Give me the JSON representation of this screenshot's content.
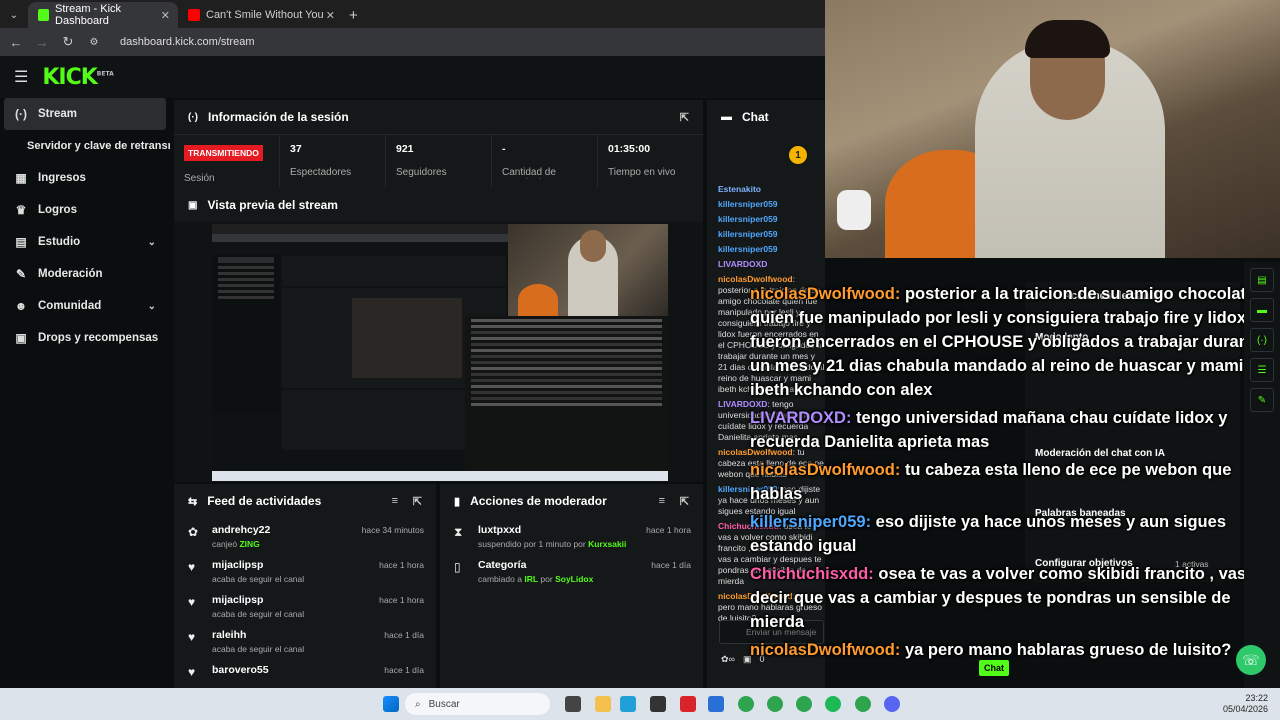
{
  "browser": {
    "tabs": [
      {
        "label": "Stream - Kick Dashboard",
        "close": "✕",
        "active": true
      },
      {
        "label": "Can't Smile Without You - Barr",
        "close": "✕",
        "active": false
      }
    ],
    "new_tab": "+",
    "url": "dashboard.kick.com/stream"
  },
  "kick": {
    "logo": "KICK",
    "logo_tag": "BETA",
    "sidebar": [
      {
        "label": "Stream",
        "icon": "stream-icon",
        "glyph": "(·)",
        "active": true
      },
      {
        "label": "Servidor y clave de retransmisión",
        "icon": "",
        "glyph": ""
      },
      {
        "label": "Ingresos",
        "icon": "dollar-icon",
        "glyph": "▦"
      },
      {
        "label": "Logros",
        "icon": "trophy-icon",
        "glyph": "♛"
      },
      {
        "label": "Estudio",
        "icon": "studio-icon",
        "glyph": "▤",
        "chevron": "⌄"
      },
      {
        "label": "Moderación",
        "icon": "wrench-icon",
        "glyph": "✎"
      },
      {
        "label": "Comunidad",
        "icon": "community-icon",
        "glyph": "☻",
        "chevron": "⌄"
      },
      {
        "label": "Drops y recompensas",
        "icon": "gift-icon",
        "glyph": "▣"
      }
    ],
    "session": {
      "title": "Información de la sesión",
      "status_badge": "TRANSMITIENDO",
      "status_label": "Sesión",
      "stats": [
        {
          "value": "37",
          "label": "Espectadores"
        },
        {
          "value": "921",
          "label": "Seguidores"
        },
        {
          "value": "-",
          "label": "Cantidad de suscripciones"
        },
        {
          "value": "01:35:00",
          "label": "Tiempo en vivo"
        }
      ]
    },
    "preview": {
      "title": "Vista previa del stream"
    },
    "feed": {
      "title": "Feed de actividades",
      "items": [
        {
          "name": "andrehcy22",
          "action": "canjeó",
          "highlight": "ZING",
          "time": "hace 34 minutos",
          "icon": "reward-icon",
          "glyph": "✿"
        },
        {
          "name": "mijaclipsp",
          "action": "acaba de seguir el canal",
          "highlight": "",
          "time": "hace 1 hora",
          "icon": "heart-icon",
          "glyph": "♥"
        },
        {
          "name": "mijaclipsp",
          "action": "acaba de seguir el canal",
          "highlight": "",
          "time": "hace 1 hora",
          "icon": "heart-icon",
          "glyph": "♥"
        },
        {
          "name": "raleihh",
          "action": "acaba de seguir el canal",
          "highlight": "",
          "time": "hace 1 día",
          "icon": "heart-icon",
          "glyph": "♥"
        },
        {
          "name": "barovero55",
          "action": "",
          "highlight": "",
          "time": "hace 1 día",
          "icon": "heart-icon",
          "glyph": "♥"
        }
      ]
    },
    "modactions": {
      "title": "Acciones de moderador",
      "items": [
        {
          "name": "luxtpxxd",
          "pre": "suspendido por 1 minuto por",
          "by": "Kurxsakii",
          "time": "hace 1 hora",
          "icon": "hourglass-icon",
          "glyph": "⧗"
        },
        {
          "name": "Categoría",
          "pre": "cambiado a",
          "mid": "IRL",
          "post": "por",
          "by": "SoyLidox",
          "time": "hace 1 día",
          "icon": "category-icon",
          "glyph": "▯"
        }
      ]
    },
    "chat": {
      "title": "Chat",
      "messages": [
        {
          "user": "Estenakito",
          "color": "#7fb2ff",
          "text": ""
        },
        {
          "user": "killersniper059",
          "color": "#4fa8ff",
          "text": ""
        },
        {
          "user": "killersniper059",
          "color": "#4fa8ff",
          "text": ""
        },
        {
          "user": "killersniper059",
          "color": "#4fa8ff",
          "text": ""
        },
        {
          "user": "killersniper059",
          "color": "#4fa8ff",
          "text": ""
        },
        {
          "user": "LIVARDOXD",
          "color": "#b18cff",
          "text": ""
        },
        {
          "user": "nicolasDwolfwood",
          "color": "#ff9b2f",
          "text": "posterior a la traicion de su amigo chocolate quien fue manipulado por lesli y consiguiera trabajo fire y lidox fueron encerrados en el CPHOUSE y obligados a trabajar durante un mes y 21 dias chabula mandado al reino de huascar y mami ibeth kchando con alex"
        },
        {
          "user": "LIVARDOXD",
          "color": "#b18cff",
          "text": "tengo universidad mañana chau cuídate lidox y recuerda Danielita aprieta mas"
        },
        {
          "user": "nicolasDwolfwood",
          "color": "#ff9b2f",
          "text": "tu cabeza esta lleno de ece pe webon que hablas"
        },
        {
          "user": "killersniper059",
          "color": "#4fa8ff",
          "text": "eso dijiste ya hace unos meses y aun sigues estando igual"
        },
        {
          "user": "Chichuchisxdd",
          "color": "#ff5ca8",
          "text": "osea te vas a volver como skibidi francito , vas a decir que vas a cambiar y despues te pondras un sensible de mierda"
        },
        {
          "user": "nicolasDwolfwood",
          "color": "#ff9b2f",
          "text": "ya pero mano hablaras grueso de luisito?"
        }
      ],
      "input_placeholder": "Enviar un mensaje",
      "send_label": "Chat",
      "counter": "0"
    }
  },
  "overlay": {
    "lines": [
      {
        "user": "nicolasDwolfwood:",
        "cls": "u",
        "text": "posterior a la traicion de su amigo chocolate quien fue manipulado por lesli y consiguiera trabajo fire y lidox fueron encerrados en el CPHOUSE y obligados a trabajar durante un mes y 21 dias chabula mandado al reino de huascar y mami ibeth kchando con alex"
      },
      {
        "user": "LIVARDOXD:",
        "cls": "u4",
        "text": "tengo universidad mañana chau cuídate lidox y recuerda Danielita aprieta mas"
      },
      {
        "user": "nicolasDwolfwood:",
        "cls": "u",
        "text": "tu cabeza esta lleno de ece pe webon que hablas"
      },
      {
        "user": "killersniper059:",
        "cls": "u2",
        "text": "eso dijiste ya hace unos meses y aun sigues estando igual"
      },
      {
        "user": "Chichuchisxdd:",
        "cls": "u3",
        "text": "osea te vas a volver como skibidi francito , vas a decir que vas a cambiar y despues te pondras un sensible de mierda"
      },
      {
        "user": "nicolasDwolfwood:",
        "cls": "u",
        "text": "ya pero mano hablaras grueso de luisito?"
      }
    ]
  },
  "actions_panel": {
    "title": "Acciones de canal",
    "items": [
      {
        "label": "Modo lento"
      },
      {
        "label": "Moderación del chat con IA"
      },
      {
        "label": "Palabras baneadas"
      },
      {
        "label": "Configurar objetivos",
        "extra": "1 activas"
      }
    ]
  },
  "taskbar": {
    "search_placeholder": "Buscar",
    "time": "23:22",
    "date": "05/04/2026"
  },
  "colors": {
    "accent": "#53fc18",
    "live": "#e41b23"
  }
}
